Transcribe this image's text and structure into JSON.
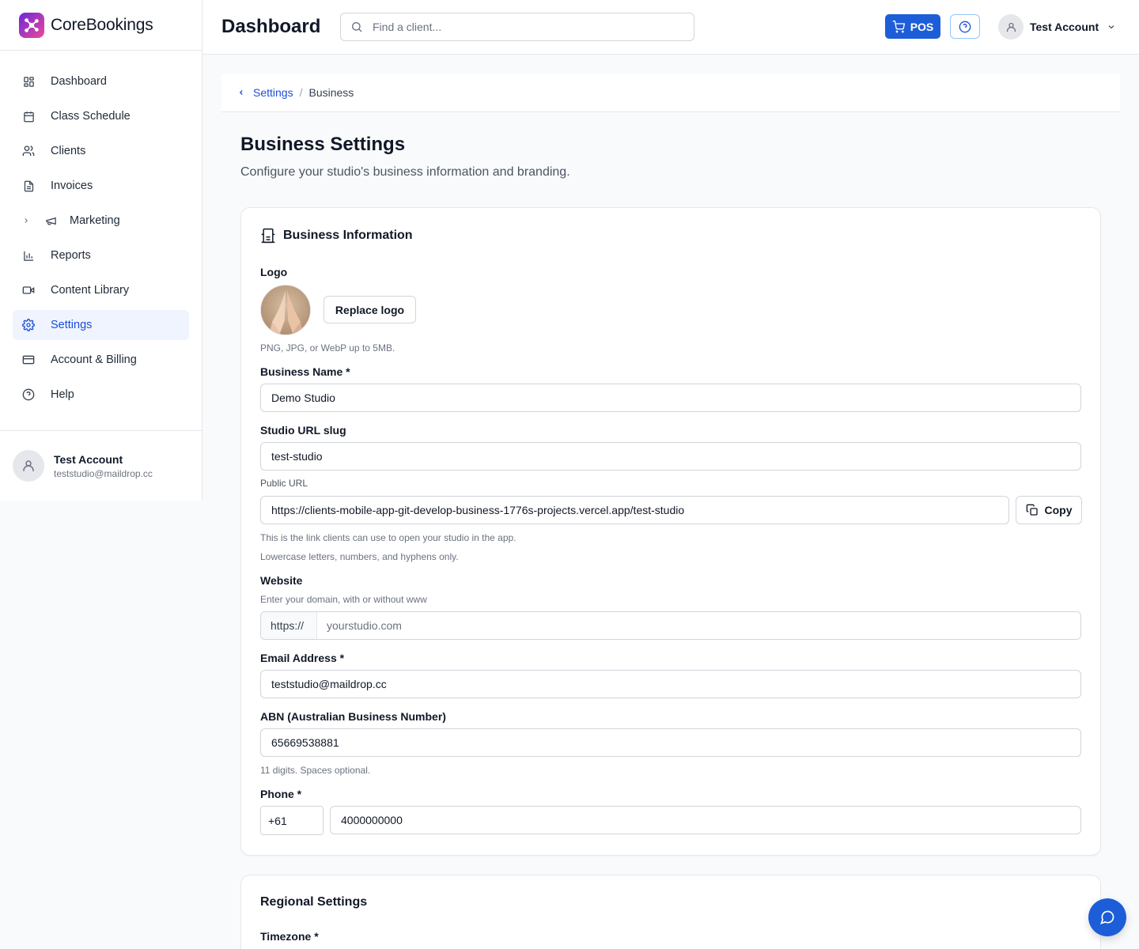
{
  "brand": {
    "name": "CoreBookings",
    "accent": "#1d5ed8"
  },
  "sidebar": {
    "items": [
      {
        "label": "Dashboard",
        "icon": "dashboard-grid-icon"
      },
      {
        "label": "Class Schedule",
        "icon": "calendar-icon"
      },
      {
        "label": "Clients",
        "icon": "users-icon"
      },
      {
        "label": "Invoices",
        "icon": "file-text-icon"
      },
      {
        "label": "Marketing",
        "icon": "megaphone-icon"
      },
      {
        "label": "Reports",
        "icon": "bar-chart-icon"
      },
      {
        "label": "Content Library",
        "icon": "video-icon"
      },
      {
        "label": "Settings",
        "icon": "gear-icon",
        "active": true
      },
      {
        "label": "Account & Billing",
        "icon": "credit-card-icon"
      },
      {
        "label": "Help",
        "icon": "help-circle-icon"
      }
    ],
    "user": {
      "name": "Test Account",
      "email": "teststudio@maildrop.cc"
    }
  },
  "header": {
    "title": "Dashboard",
    "search_placeholder": "Find a client...",
    "pos_label": "POS",
    "account_name": "Test Account"
  },
  "breadcrumb": {
    "parent": "Settings",
    "separator": "/",
    "current": "Business"
  },
  "page": {
    "title": "Business Settings",
    "subtitle": "Configure your studio's business information and branding."
  },
  "business_info": {
    "heading": "Business Information",
    "logo_label": "Logo",
    "replace_logo": "Replace logo",
    "logo_hint": "PNG, JPG, or WebP up to 5MB.",
    "business_name_label": "Business Name *",
    "business_name": "Demo Studio",
    "slug_label": "Studio URL slug",
    "slug": "test-studio",
    "public_url_label": "Public URL",
    "public_url": "https://clients-mobile-app-git-develop-business-1776s-projects.vercel.app/test-studio",
    "copy_label": "Copy",
    "public_url_hint": "This is the link clients can use to open your studio in the app.",
    "slug_hint": "Lowercase letters, numbers, and hyphens only.",
    "website_label": "Website",
    "website_hint": "Enter your domain, with or without www",
    "website_prefix": "https://",
    "website_placeholder": "yourstudio.com",
    "email_label": "Email Address *",
    "email": "teststudio@maildrop.cc",
    "abn_label": "ABN (Australian Business Number)",
    "abn": "65669538881",
    "abn_hint": "11 digits. Spaces optional.",
    "phone_label": "Phone *",
    "phone_code": "+61",
    "phone": "4000000000"
  },
  "regional": {
    "heading": "Regional Settings",
    "timezone_label": "Timezone *"
  }
}
